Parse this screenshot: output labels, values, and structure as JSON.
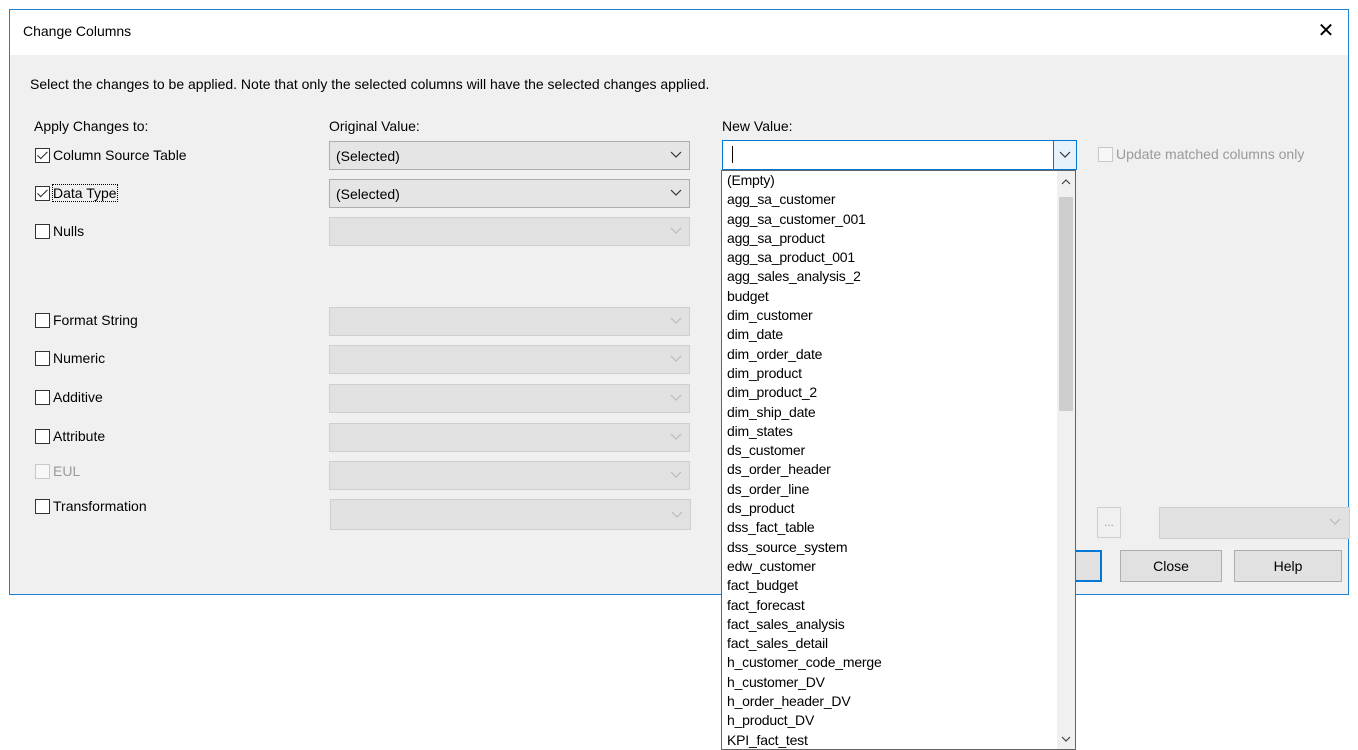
{
  "window": {
    "title": "Change Columns",
    "close_icon": "close-icon"
  },
  "instruction": "Select the changes to be applied. Note that only the selected columns will have the selected changes applied.",
  "headers": {
    "apply": "Apply Changes to:",
    "original": "Original Value:",
    "new": "New Value:"
  },
  "rows": [
    {
      "label": "Column Source Table",
      "checked": true,
      "original": "(Selected)"
    },
    {
      "label": "Data Type",
      "checked": true,
      "original": "(Selected)"
    },
    {
      "label": "Nulls",
      "checked": false,
      "original": ""
    },
    {
      "label": "Format String",
      "checked": false,
      "original": ""
    },
    {
      "label": "Numeric",
      "checked": false,
      "original": ""
    },
    {
      "label": "Additive",
      "checked": false,
      "original": ""
    },
    {
      "label": "Attribute",
      "checked": false,
      "original": ""
    },
    {
      "label": "EUL",
      "checked": false,
      "disabled": true,
      "original": ""
    },
    {
      "label": "Transformation",
      "checked": false,
      "original": ""
    }
  ],
  "new_value": {
    "current": "",
    "update_matched_only": "Update matched columns only",
    "options": [
      "(Empty)",
      "agg_sa_customer",
      "agg_sa_customer_001",
      "agg_sa_product",
      "agg_sa_product_001",
      "agg_sales_analysis_2",
      "budget",
      "dim_customer",
      "dim_date",
      "dim_order_date",
      "dim_product",
      "dim_product_2",
      "dim_ship_date",
      "dim_states",
      "ds_customer",
      "ds_order_header",
      "ds_order_line",
      "ds_product",
      "dss_fact_table",
      "dss_source_system",
      "edw_customer",
      "fact_budget",
      "fact_forecast",
      "fact_sales_analysis",
      "fact_sales_detail",
      "h_customer_code_merge",
      "h_customer_DV",
      "h_order_header_DV",
      "h_product_DV",
      "KPI_fact_test"
    ]
  },
  "buttons": {
    "ellipsis": "...",
    "close": "Close",
    "help": "Help"
  },
  "colors": {
    "accent": "#0078d7",
    "dialog_bg": "#f0f0f0",
    "border": "#1883d7"
  }
}
